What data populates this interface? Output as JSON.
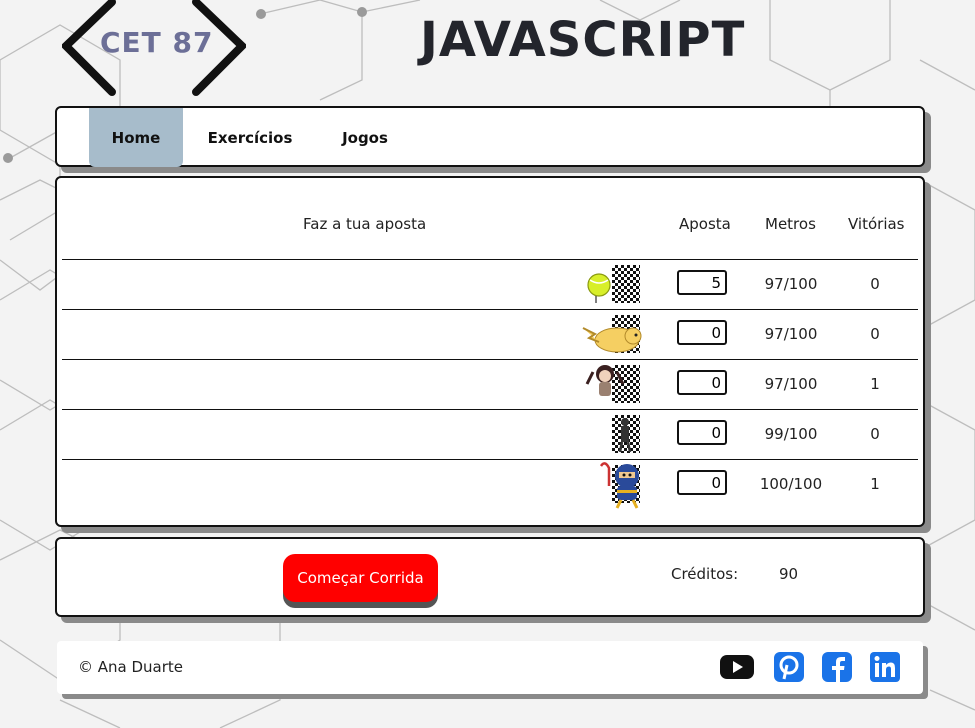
{
  "header": {
    "logo_text": "CET 87",
    "title": "JAVASCRIPT"
  },
  "nav": {
    "items": [
      {
        "label": "Home",
        "active": true
      },
      {
        "label": "Exercícios"
      },
      {
        "label": "Jogos"
      }
    ],
    "active_color": "#a7bccb"
  },
  "race": {
    "headers": {
      "bet_prompt": "Faz a tua aposta",
      "bet": "Aposta",
      "meters": "Metros",
      "wins": "Vitórias"
    },
    "runners": [
      {
        "icon": "tennis-ball-icon",
        "bet": "5",
        "meters": "97/100",
        "wins": "0"
      },
      {
        "icon": "pikachu-icon",
        "bet": "0",
        "meters": "97/100",
        "wins": "0"
      },
      {
        "icon": "girl-character-icon",
        "bet": "0",
        "meters": "97/100",
        "wins": "1"
      },
      {
        "icon": "shadow-figure-icon",
        "bet": "0",
        "meters": "99/100",
        "wins": "0"
      },
      {
        "icon": "ninja-character-icon",
        "bet": "0",
        "meters": "100/100",
        "wins": "1"
      }
    ]
  },
  "controls": {
    "start_label": "Começar Corrida",
    "credits_label": "Créditos:",
    "credits_value": "90",
    "start_color": "#ff0000"
  },
  "footer": {
    "copyright": "© Ana Duarte",
    "social": [
      {
        "icon": "youtube-icon",
        "color": "#111111"
      },
      {
        "icon": "pinterest-icon",
        "color": "#1a73e8"
      },
      {
        "icon": "facebook-icon",
        "color": "#1a73e8"
      },
      {
        "icon": "linkedin-icon",
        "color": "#1a73e8"
      }
    ]
  }
}
